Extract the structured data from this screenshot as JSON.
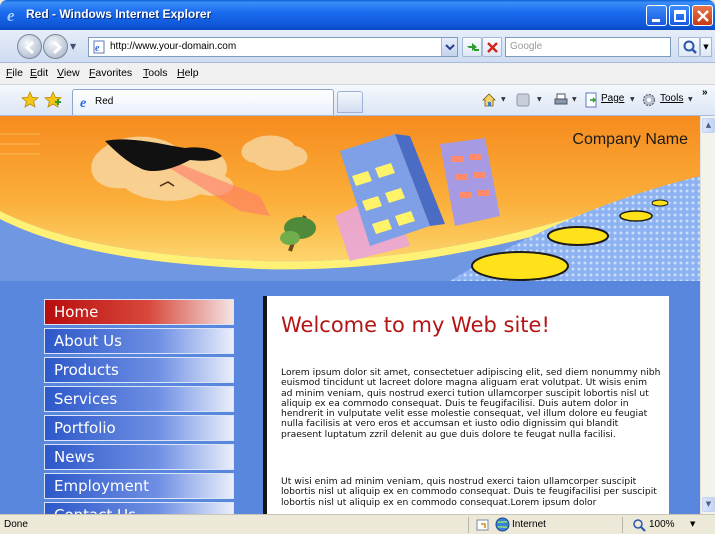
{
  "window": {
    "title": "Red - Windows Internet Explorer"
  },
  "address_bar": {
    "url": "http://www.your-domain.com",
    "search_placeholder": "Google"
  },
  "menu": {
    "items": [
      "File",
      "Edit",
      "View",
      "Favorites",
      "Tools",
      "Help"
    ]
  },
  "tabs": [
    {
      "label": "Red"
    }
  ],
  "command_bar": {
    "page_label": "Page",
    "tools_label": "Tools"
  },
  "page": {
    "company_name": "Company Name",
    "nav": [
      "Home",
      "About Us",
      "Products",
      "Services",
      "Portfolio",
      "News",
      "Employment",
      "Contact Us"
    ],
    "heading": "Welcome to my Web site!",
    "paragraphs": [
      "Lorem ipsum dolor sit amet, consectetuer adipiscing elit, sed diem nonummy nibh euismod tincidunt ut lacreet dolore magna aliguam erat volutpat. Ut wisis enim ad minim veniam, quis nostrud exerci tution ullamcorper suscipit lobortis nisl ut aliquip ex ea commodo consequat. Duis te feugifacilisi. Duis autem dolor in hendrerit in vulputate velit esse molestie consequat, vel illum dolore eu feugiat nulla facilisis at vero eros et accumsan et iusto odio dignissim qui blandit praesent luptatum zzril delenit au gue duis dolore te feugat nulla facilisi.",
      "Ut wisi enim ad minim veniam, quis nostrud exerci taion ullamcorper suscipit lobortis nisl ut aliquip ex en commodo consequat. Duis te feugifacilisi per suscipit lobortis nisl ut aliquip ex en commodo consequat.Lorem ipsum dolor"
    ],
    "colors": {
      "accent_red": "#b31515",
      "nav_blue": "#2d58c9",
      "page_background": "#5987de",
      "banner_orange": "#f7a532"
    }
  },
  "status_bar": {
    "status": "Done",
    "zone": "Internet",
    "zoom": "100%"
  }
}
